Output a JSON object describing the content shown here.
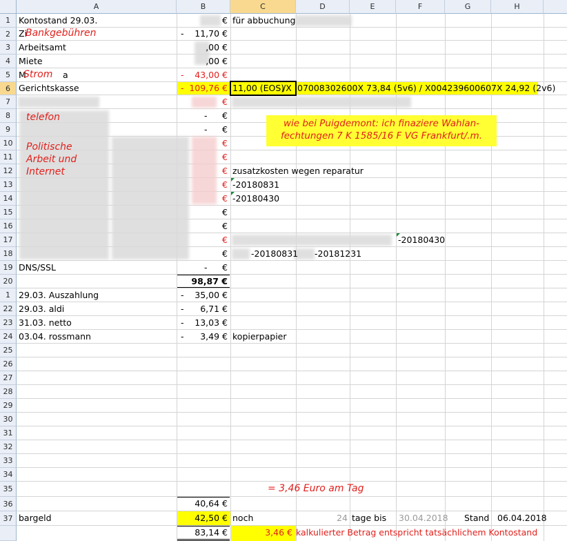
{
  "columns": [
    "A",
    "B",
    "C",
    "D",
    "E",
    "F",
    "G",
    "H"
  ],
  "rows": [
    "1",
    "2",
    "3",
    "4",
    "5",
    "6",
    "7",
    "8",
    "9",
    "10",
    "11",
    "12",
    "13",
    "14",
    "15",
    "16",
    "17",
    "18",
    "19",
    "20",
    "21",
    "22",
    "23",
    "24",
    "25",
    "26",
    "27",
    "28",
    "29",
    "30",
    "31",
    "32",
    "33",
    "34",
    "35",
    "36",
    "37"
  ],
  "cells": {
    "a1": "Kontostand 29.03.",
    "b1": "€",
    "c1": "für abbuchung",
    "a2": "Zi",
    "b2_sign": "-",
    "b2": "11,70 €",
    "a3": "Arbeitsamt",
    "b3": ",00 €",
    "a4": "Miete",
    "b4": ",00 €",
    "a5": "M",
    "a5b": "a",
    "b5_sign": "-",
    "b5": "43,00 €",
    "a6": "Gerichtskasse",
    "b6_sign": "-",
    "b6": "109,76 €",
    "c6": "11,00 (EOS)",
    "c6b": "/X",
    "d6": "07008302600X 73,84 (5v6) / X004239600607X 24,92 (2v6)",
    "b7": "€",
    "b8_sign": "-",
    "b8": "€",
    "b9_sign": "-",
    "b9": "€",
    "b10": "€",
    "b11": "€",
    "b12": "€",
    "c12": "zusatzkosten wegen reparatur",
    "b13": "€",
    "c13": "-20180831",
    "b14": "€",
    "c14": "-20180430",
    "b15": "€",
    "b16": "€",
    "b17": "€",
    "f17": "-20180430",
    "b18": "€",
    "c18a": "-20180831",
    "c18b": "-20181231",
    "a19": "DNS/SSL",
    "b19_sign": "-",
    "b19": "€",
    "b20": "98,87 €",
    "a21": "29.03. Auszahlung",
    "b21_sign": "-",
    "b21": "35,00 €",
    "a22": "29.03. aldi",
    "b22_sign": "-",
    "b22": "6,71 €",
    "a23": "31.03. netto",
    "b23_sign": "-",
    "b23": "13,03 €",
    "a24": "03.04. rossmann",
    "b24_sign": "-",
    "b24": "3,49 €",
    "c24": "kopierpapier",
    "b36": "40,64 €",
    "a37": "bargeld",
    "b37": "42,50 €",
    "c37": "noch",
    "d37": "24",
    "e37": "tage bis",
    "f37": "30.04.2018",
    "g37": "Stand",
    "h37": "06.04.2018",
    "b38": "83,14 €",
    "c38": "3,46 €",
    "d38": "kalkulierter Betrag entspricht tatsächlichem Kontostand"
  },
  "overlays": {
    "bankgebuehren": "Bankgebühren",
    "strom": "Strom",
    "telefon": "telefon",
    "politische": "Politische",
    "arbeit": "Arbeit und",
    "internet": "Internet",
    "note_line1": "wie bei Puigdemont: ich finaziere Wahlan-",
    "note_line2": "fechtungen 7 K 1585/16 F VG Frankfurt/.m.",
    "per_day": "= 3,46 Euro am Tag"
  },
  "colors": {
    "highlight": "#ffff00",
    "red_text": "#e0201c",
    "header_bg": "#e9eef7",
    "grid": "#d4d4d4"
  }
}
